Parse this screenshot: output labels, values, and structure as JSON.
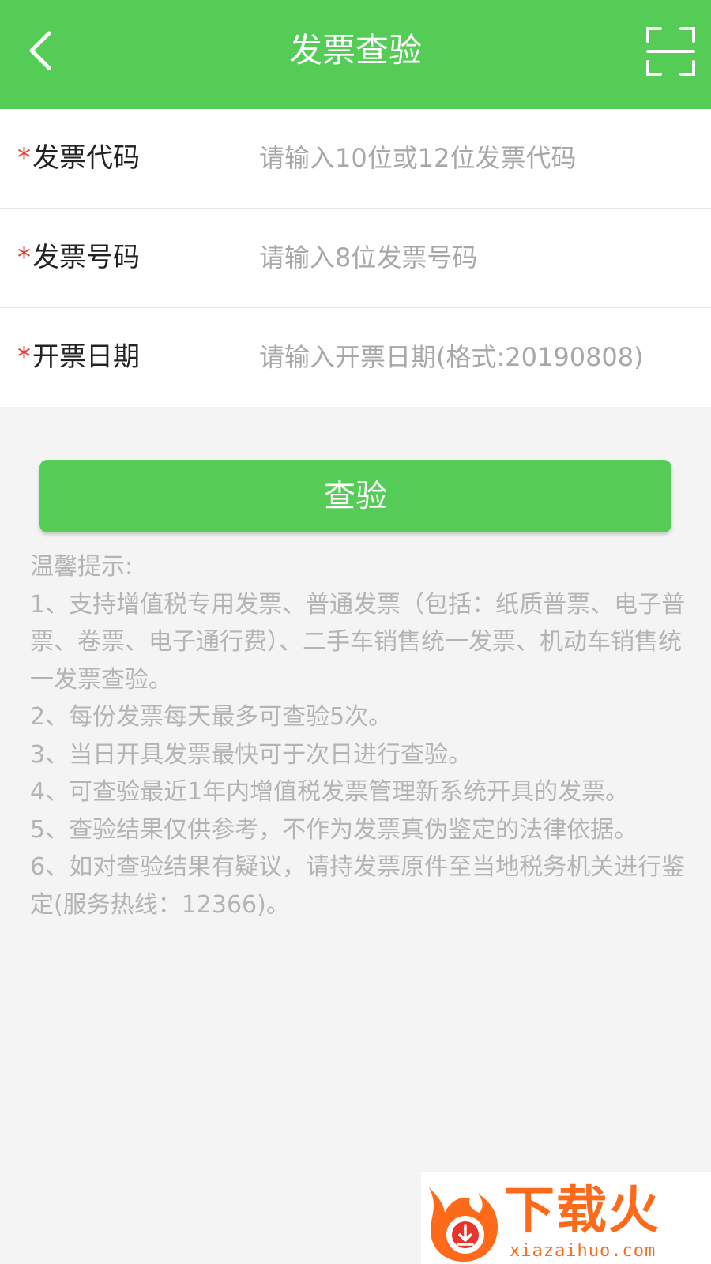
{
  "header": {
    "title": "发票查验",
    "back_icon": "chevron-left-icon",
    "scan_icon": "scan-icon",
    "bg_color": "#55cc55"
  },
  "form": {
    "required_mark": "*",
    "fields": [
      {
        "label": "发票代码",
        "placeholder": "请输入10位或12位发票代码",
        "value": ""
      },
      {
        "label": "发票号码",
        "placeholder": "请输入8位发票号码",
        "value": ""
      },
      {
        "label": "开票日期",
        "placeholder": "请输入开票日期(格式:20190808)",
        "value": ""
      }
    ]
  },
  "submit_label": "查验",
  "tips": {
    "title": "温馨提示:",
    "lines": [
      "1、支持增值税专用发票、普通发票（包括：纸质普票、电子普票、卷票、电子通行费）、二手车销售统一发票、机动车销售统一发票查验。",
      "2、每份发票每天最多可查验5次。",
      "3、当日开具发票最快可于次日进行查验。",
      "4、可查验最近1年内增值税发票管理新系统开具的发票。",
      "5、查验结果仅供参考，不作为发票真伪鉴定的法律依据。",
      "6、如对查验结果有疑议，请持发票原件至当地税务机关进行鉴定(服务热线：12366)。"
    ]
  },
  "watermark": {
    "text": "下载火",
    "url": "xiazaihuo.com",
    "color": "#ff6a1a"
  }
}
